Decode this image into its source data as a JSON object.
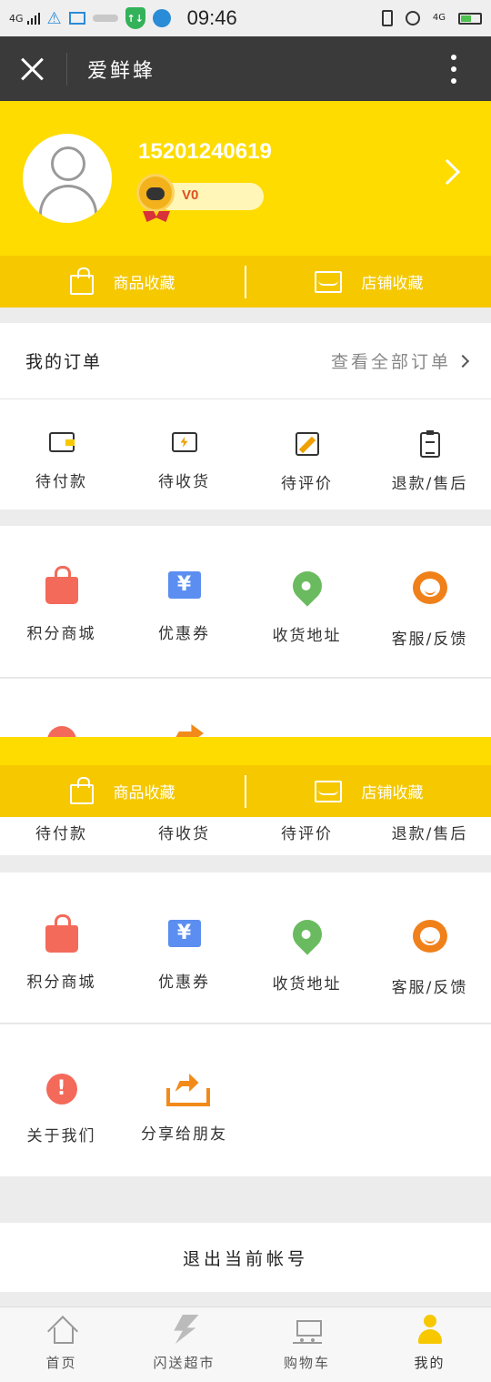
{
  "status_bar": {
    "signal_left": "4G",
    "time": "09:46",
    "signal_right": "4G"
  },
  "titlebar": {
    "title": "爱鲜蜂"
  },
  "profile": {
    "phone": "15201240619",
    "level": "V0"
  },
  "favorites": {
    "goods": "商品收藏",
    "shops": "店铺收藏"
  },
  "orders": {
    "title": "我的订单",
    "view_all": "查看全部订单",
    "items": [
      {
        "label": "待付款",
        "icon": "wallet-icon"
      },
      {
        "label": "待收货",
        "icon": "delivery-truck-icon"
      },
      {
        "label": "待评价",
        "icon": "edit-icon"
      },
      {
        "label": "退款/售后",
        "icon": "clipboard-icon"
      }
    ]
  },
  "services": {
    "items": [
      {
        "label": "积分商城",
        "icon": "shopping-bag-icon"
      },
      {
        "label": "优惠券",
        "icon": "coupon-icon",
        "glyph": "¥"
      },
      {
        "label": "收货地址",
        "icon": "location-pin-icon"
      },
      {
        "label": "客服/反馈",
        "icon": "customer-service-icon"
      }
    ]
  },
  "more": {
    "items": [
      {
        "label": "关于我们",
        "icon": "info-icon",
        "glyph": "!"
      },
      {
        "label": "分享给朋友",
        "icon": "share-icon"
      }
    ]
  },
  "logout": "退出当前帐号",
  "tabbar": {
    "items": [
      {
        "label": "首页",
        "icon": "home-icon"
      },
      {
        "label": "闪送超市",
        "icon": "lightning-icon"
      },
      {
        "label": "购物车",
        "icon": "cart-icon"
      },
      {
        "label": "我的",
        "icon": "user-icon"
      }
    ],
    "active": "我的"
  },
  "colors": {
    "brand_yellow": "#fedc00",
    "favbar_yellow": "#f5c800",
    "titlebar": "#3a3a3a"
  }
}
